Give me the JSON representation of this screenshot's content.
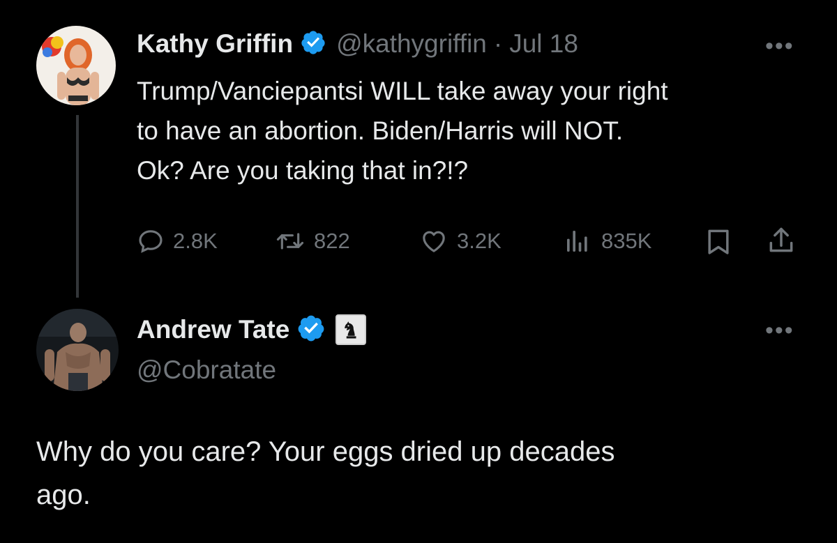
{
  "tweet1": {
    "name": "Kathy Griffin",
    "handle": "@kathygriffin",
    "separator": "·",
    "date": "Jul 18",
    "more": "•••",
    "text_lines": [
      "Trump/Vanciepantsi WILL take away your right",
      "to have an abortion. Biden/Harris will NOT.",
      "Ok? Are you taking that in?!?"
    ],
    "actions": {
      "replies": "2.8K",
      "retweets": "822",
      "likes": "3.2K",
      "views": "835K"
    }
  },
  "tweet2": {
    "name": "Andrew Tate",
    "handle": "@Cobratate",
    "more": "•••",
    "text_lines": [
      "Why do you care? Your eggs dried up decades",
      "ago."
    ]
  },
  "colors": {
    "background": "#000000",
    "text": "#e7e9ea",
    "muted": "#71767b",
    "verified": "#1d9bf0",
    "thread_line": "#333639"
  },
  "icons": {
    "verified": "verified-badge-icon",
    "reply": "reply-icon",
    "retweet": "retweet-icon",
    "like": "heart-icon",
    "views": "views-chart-icon",
    "bookmark": "bookmark-icon",
    "share": "share-icon",
    "affiliate": "chess-knight-icon",
    "more": "more-options-icon"
  }
}
